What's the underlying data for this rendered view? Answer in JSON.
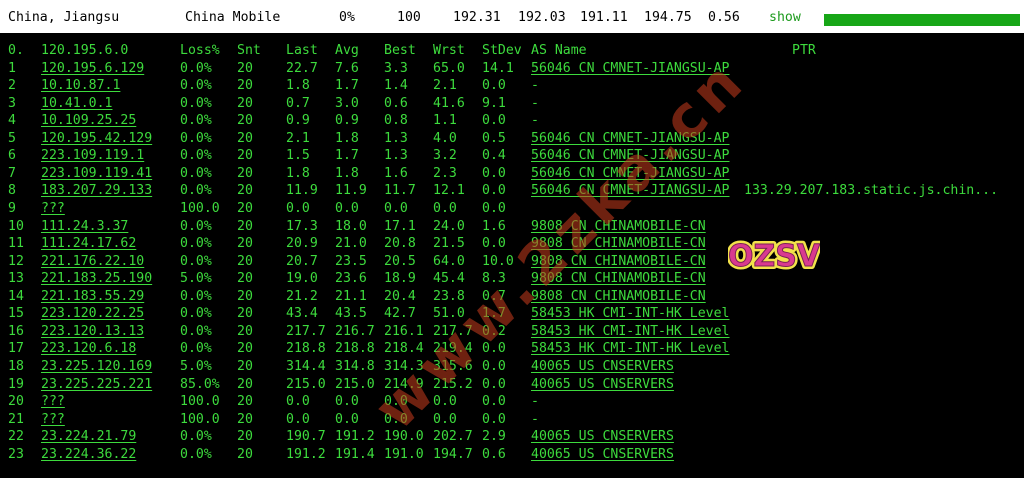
{
  "topbar": {
    "location": "China, Jiangsu",
    "isp": "China Mobile",
    "loss": "0%",
    "sent": "100",
    "last": "192.31",
    "avg": "192.03",
    "best": "191.11",
    "worst": "194.75",
    "stdev": "0.56",
    "show_label": "show",
    "bar_color": "#17a617"
  },
  "header": {
    "hop": "0.",
    "host": "120.195.6.0",
    "loss": "Loss%",
    "snt": "Snt",
    "last": "Last",
    "avg": "Avg",
    "best": "Best",
    "wrst": "Wrst",
    "stdev": "StDev",
    "as_name": "AS Name",
    "ptr": "PTR"
  },
  "hops": [
    {
      "hop": "1",
      "host": "120.195.6.129",
      "loss": "0.0%",
      "snt": "20",
      "last": "22.7",
      "avg": "7.6",
      "best": "3.3",
      "wrst": "65.0",
      "stdev": "14.1",
      "as": "56046 CN CMNET-JIANGSU-AP",
      "ptr": ""
    },
    {
      "hop": "2",
      "host": "10.10.87.1",
      "loss": "0.0%",
      "snt": "20",
      "last": "1.8",
      "avg": "1.7",
      "best": "1.4",
      "wrst": "2.1",
      "stdev": "0.0",
      "as": "-",
      "ptr": ""
    },
    {
      "hop": "3",
      "host": "10.41.0.1",
      "loss": "0.0%",
      "snt": "20",
      "last": "0.7",
      "avg": "3.0",
      "best": "0.6",
      "wrst": "41.6",
      "stdev": "9.1",
      "as": "-",
      "ptr": ""
    },
    {
      "hop": "4",
      "host": "10.109.25.25",
      "loss": "0.0%",
      "snt": "20",
      "last": "0.9",
      "avg": "0.9",
      "best": "0.8",
      "wrst": "1.1",
      "stdev": "0.0",
      "as": "-",
      "ptr": ""
    },
    {
      "hop": "5",
      "host": "120.195.42.129",
      "loss": "0.0%",
      "snt": "20",
      "last": "2.1",
      "avg": "1.8",
      "best": "1.3",
      "wrst": "4.0",
      "stdev": "0.5",
      "as": "56046 CN CMNET-JIANGSU-AP",
      "ptr": ""
    },
    {
      "hop": "6",
      "host": "223.109.119.1",
      "loss": "0.0%",
      "snt": "20",
      "last": "1.5",
      "avg": "1.7",
      "best": "1.3",
      "wrst": "3.2",
      "stdev": "0.4",
      "as": "56046 CN CMNET-JIANGSU-AP",
      "ptr": ""
    },
    {
      "hop": "7",
      "host": "223.109.119.41",
      "loss": "0.0%",
      "snt": "20",
      "last": "1.8",
      "avg": "1.8",
      "best": "1.6",
      "wrst": "2.3",
      "stdev": "0.0",
      "as": "56046 CN CMNET-JIANGSU-AP",
      "ptr": ""
    },
    {
      "hop": "8",
      "host": "183.207.29.133",
      "loss": "0.0%",
      "snt": "20",
      "last": "11.9",
      "avg": "11.9",
      "best": "11.7",
      "wrst": "12.1",
      "stdev": "0.0",
      "as": "56046 CN CMNET-JIANGSU-AP",
      "ptr": "133.29.207.183.static.js.chin..."
    },
    {
      "hop": "9",
      "host": "???",
      "loss": "100.0",
      "snt": "20",
      "last": "0.0",
      "avg": "0.0",
      "best": "0.0",
      "wrst": "0.0",
      "stdev": "0.0",
      "as": "",
      "ptr": ""
    },
    {
      "hop": "10",
      "host": "111.24.3.37",
      "loss": "0.0%",
      "snt": "20",
      "last": "17.3",
      "avg": "18.0",
      "best": "17.1",
      "wrst": "24.0",
      "stdev": "1.6",
      "as": "9808  CN CHINAMOBILE-CN",
      "ptr": ""
    },
    {
      "hop": "11",
      "host": "111.24.17.62",
      "loss": "0.0%",
      "snt": "20",
      "last": "20.9",
      "avg": "21.0",
      "best": "20.8",
      "wrst": "21.5",
      "stdev": "0.0",
      "as": "9808  CN CHINAMOBILE-CN",
      "ptr": ""
    },
    {
      "hop": "12",
      "host": "221.176.22.10",
      "loss": "0.0%",
      "snt": "20",
      "last": "20.7",
      "avg": "23.5",
      "best": "20.5",
      "wrst": "64.0",
      "stdev": "10.0",
      "as": "9808  CN CHINAMOBILE-CN",
      "ptr": ""
    },
    {
      "hop": "13",
      "host": "221.183.25.190",
      "loss": "5.0%",
      "snt": "20",
      "last": "19.0",
      "avg": "23.6",
      "best": "18.9",
      "wrst": "45.4",
      "stdev": "8.3",
      "as": "9808  CN CHINAMOBILE-CN",
      "ptr": ""
    },
    {
      "hop": "14",
      "host": "221.183.55.29",
      "loss": "0.0%",
      "snt": "20",
      "last": "21.2",
      "avg": "21.1",
      "best": "20.4",
      "wrst": "23.8",
      "stdev": "0.7",
      "as": "9808  CN CHINAMOBILE-CN",
      "ptr": ""
    },
    {
      "hop": "15",
      "host": "223.120.22.25",
      "loss": "0.0%",
      "snt": "20",
      "last": "43.4",
      "avg": "43.5",
      "best": "42.7",
      "wrst": "51.0",
      "stdev": "1.7",
      "as": "58453 HK CMI-INT-HK Level",
      "ptr": ""
    },
    {
      "hop": "16",
      "host": "223.120.13.13",
      "loss": "0.0%",
      "snt": "20",
      "last": "217.7",
      "avg": "216.7",
      "best": "216.1",
      "wrst": "217.7",
      "stdev": "0.2",
      "as": "58453 HK CMI-INT-HK Level",
      "ptr": ""
    },
    {
      "hop": "17",
      "host": "223.120.6.18",
      "loss": "0.0%",
      "snt": "20",
      "last": "218.8",
      "avg": "218.8",
      "best": "218.4",
      "wrst": "219.4",
      "stdev": "0.0",
      "as": "58453 HK CMI-INT-HK Level",
      "ptr": ""
    },
    {
      "hop": "18",
      "host": "23.225.120.169",
      "loss": "5.0%",
      "snt": "20",
      "last": "314.4",
      "avg": "314.8",
      "best": "314.3",
      "wrst": "315.6",
      "stdev": "0.0",
      "as": "40065 US CNSERVERS",
      "ptr": ""
    },
    {
      "hop": "19",
      "host": "23.225.225.221",
      "loss": "85.0%",
      "snt": "20",
      "last": "215.0",
      "avg": "215.0",
      "best": "214.9",
      "wrst": "215.2",
      "stdev": "0.0",
      "as": "40065 US CNSERVERS",
      "ptr": ""
    },
    {
      "hop": "20",
      "host": "???",
      "loss": "100.0",
      "snt": "20",
      "last": "0.0",
      "avg": "0.0",
      "best": "0.0",
      "wrst": "0.0",
      "stdev": "0.0",
      "as": "-",
      "ptr": ""
    },
    {
      "hop": "21",
      "host": "???",
      "loss": "100.0",
      "snt": "20",
      "last": "0.0",
      "avg": "0.0",
      "best": "0.0",
      "wrst": "0.0",
      "stdev": "0.0",
      "as": "-",
      "ptr": ""
    },
    {
      "hop": "22",
      "host": "23.224.21.79",
      "loss": "0.0%",
      "snt": "20",
      "last": "190.7",
      "avg": "191.2",
      "best": "190.0",
      "wrst": "202.7",
      "stdev": "2.9",
      "as": "40065 US CNSERVERS",
      "ptr": ""
    },
    {
      "hop": "23",
      "host": "23.224.36.22",
      "loss": "0.0%",
      "snt": "20",
      "last": "191.2",
      "avg": "191.4",
      "best": "191.0",
      "wrst": "194.7",
      "stdev": "0.6",
      "as": "40065 US CNSERVERS",
      "ptr": ""
    }
  ],
  "watermark": "www.2zka.cn",
  "logo": {
    "text": "OZSV",
    "fill": "#d93a8f",
    "outline": "#f2e24a"
  },
  "colors": {
    "terminal_fg": "#3ddb3d",
    "background": "#000000",
    "topbar_bg": "#ffffff"
  }
}
